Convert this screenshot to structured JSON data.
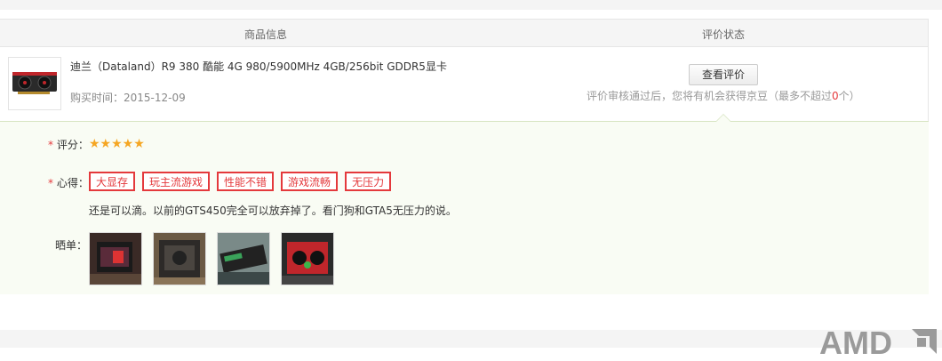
{
  "table": {
    "col_goods": "商品信息",
    "col_status": "评价状态"
  },
  "product": {
    "title": "迪兰（Dataland）R9 380 酷能 4G 980/5900MHz 4GB/256bit GDDR5显卡",
    "buy_time_label": "购买时间：",
    "buy_time": "2015-12-09"
  },
  "status": {
    "view_button": "查看评价",
    "hint_prefix": "评价审核通过后，您将有机会获得京豆（最多不超过",
    "hint_num": "0",
    "hint_suffix": "个）"
  },
  "review": {
    "rating_label": "评分：",
    "rating_value": 5,
    "stars_text": "★★★★★",
    "tags_label": "心得：",
    "tags": [
      "大显存",
      "玩主流游戏",
      "性能不错",
      "游戏流畅",
      "无压力"
    ],
    "comment": "还是可以滴。以前的GTS450完全可以放弃掉了。看门狗和GTA5无压力的说。",
    "photos_label": "晒单：",
    "photo_count": 4
  },
  "watermark": {
    "text": "AMD"
  },
  "colors": {
    "accent_red": "#e4393c",
    "star": "#f5a623",
    "review_bg": "#f9fcf4",
    "review_border": "#d7e5c2"
  }
}
